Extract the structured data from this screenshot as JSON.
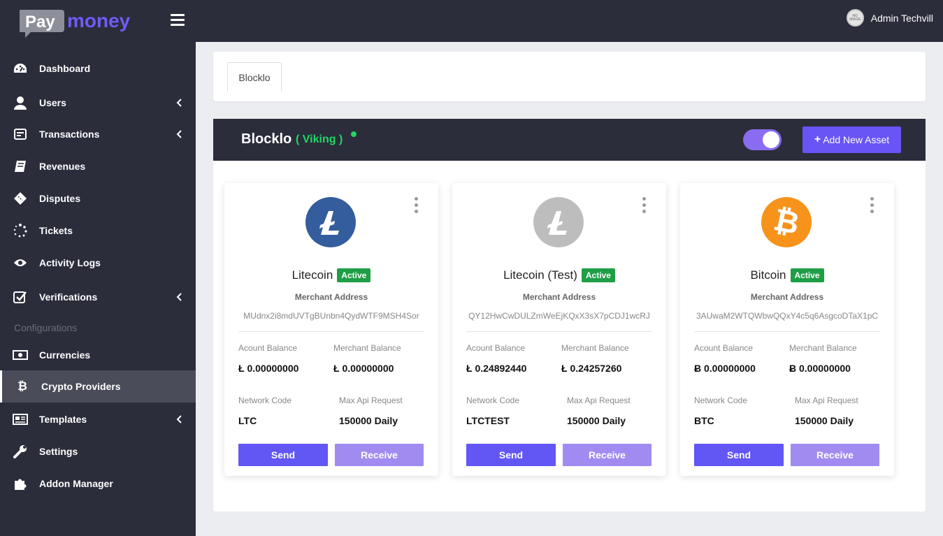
{
  "header": {
    "logo_part1": "Pay",
    "logo_part2": "money",
    "admin_name": "Admin Techvill",
    "avatar_text": "NO IMAGE"
  },
  "sidebar": {
    "items": [
      {
        "label": "Dashboard",
        "icon": "dashboard-icon"
      },
      {
        "label": "Users",
        "icon": "user-icon"
      },
      {
        "label": "Transactions",
        "icon": "transactions-icon"
      },
      {
        "label": "Revenues",
        "icon": "book-icon"
      },
      {
        "label": "Disputes",
        "icon": "ticket-icon"
      },
      {
        "label": "Tickets",
        "icon": "spinner-icon"
      },
      {
        "label": "Activity Logs",
        "icon": "eye-icon"
      },
      {
        "label": "Verifications",
        "icon": "check-square-icon"
      },
      {
        "label": "Currencies",
        "icon": "money-icon"
      },
      {
        "label": "Crypto Providers",
        "icon": "bitcoin-icon"
      },
      {
        "label": "Templates",
        "icon": "newspaper-icon"
      },
      {
        "label": "Settings",
        "icon": "wrench-icon"
      },
      {
        "label": "Addon Manager",
        "icon": "puzzle-icon"
      }
    ],
    "section_label": "Configurations",
    "active": "Crypto Providers"
  },
  "tabs": {
    "active": "Blocklo"
  },
  "panel": {
    "title": "Blocklo",
    "subtitle": "( Viking )",
    "add_button": "Add New Asset",
    "toggle_on": true
  },
  "labels": {
    "merchant_address": "Merchant Address",
    "account_balance": "Acount Balance",
    "merchant_balance": "Merchant Balance",
    "network_code": "Network Code",
    "max_api_request": "Max Api Request",
    "send": "Send",
    "receive": "Receive"
  },
  "colors": {
    "accent": "#6954f5",
    "dark": "#2b2d3b",
    "active_badge": "#1e9e45",
    "status_dot": "#1ed760"
  },
  "cards": [
    {
      "name": "Litecoin",
      "status": "Active",
      "address": "MUdnx2i8mdUVTgBUnbn4QydWTF9MSH4Sor",
      "account_balance": "Ł 0.00000000",
      "merchant_balance": "Ł 0.00000000",
      "network_code": "LTC",
      "max_api": "150000 Daily",
      "icon": "litecoin-icon",
      "coin_color": "#345d9d"
    },
    {
      "name": "Litecoin (Test)",
      "status": "Active",
      "address": "QY12HwCwDULZmWeEjKQxX3sX7pCDJ1wcRJ",
      "account_balance": "Ł 0.24892440",
      "merchant_balance": "Ł 0.24257260",
      "network_code": "LTCTEST",
      "max_api": "150000 Daily",
      "icon": "litecoin-test-icon",
      "coin_color": "#bdbdbd"
    },
    {
      "name": "Bitcoin",
      "status": "Active",
      "address": "3AUwaM2WTQWbwQQxY4c5q6AsgcoDTaX1pC",
      "account_balance": "Ƀ 0.00000000",
      "merchant_balance": "Ƀ 0.00000000",
      "network_code": "BTC",
      "max_api": "150000 Daily",
      "icon": "bitcoin-icon",
      "coin_color": "#f7931a"
    }
  ]
}
